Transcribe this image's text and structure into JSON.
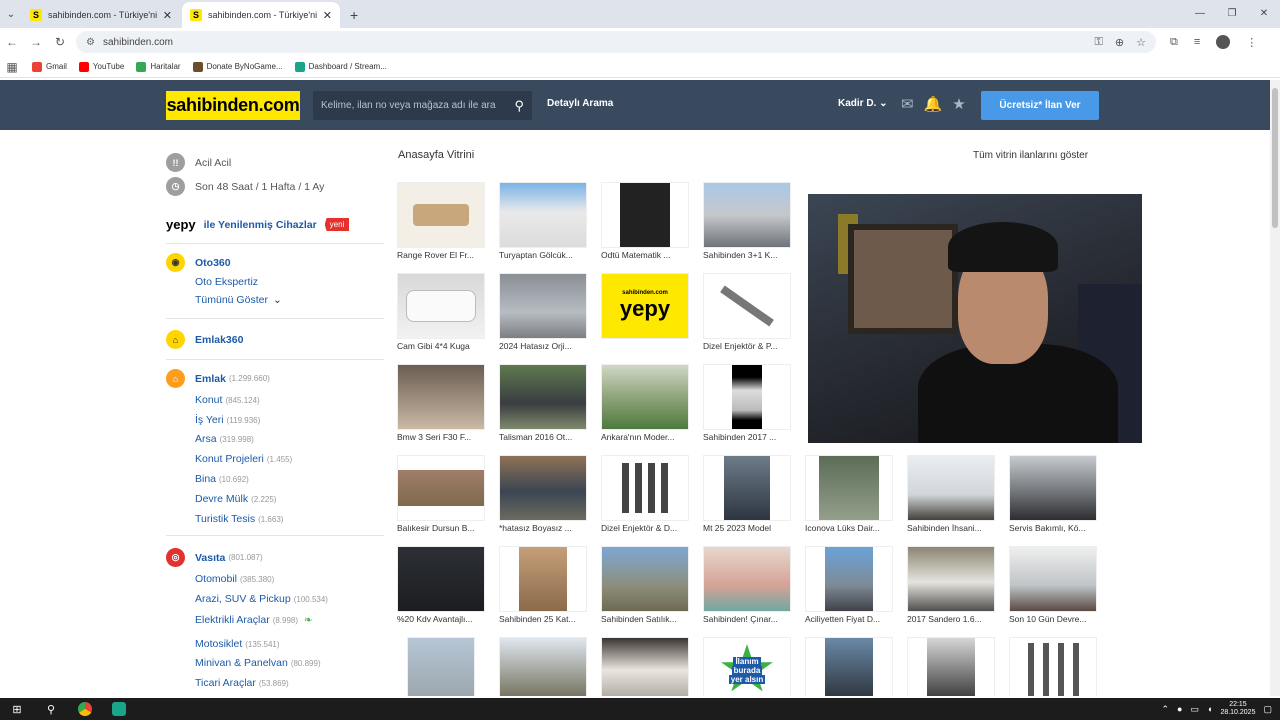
{
  "browser": {
    "tabs": [
      {
        "favicon": "S",
        "title": "sahibinden.com - Türkiye'nin O"
      },
      {
        "favicon": "S",
        "title": "sahibinden.com - Türkiye'nin O"
      }
    ],
    "new_tab": "+",
    "url": "sahibinden.com",
    "bookmarks": [
      {
        "label": "Gmail",
        "color": "#ea4335"
      },
      {
        "label": "YouTube",
        "color": "#ff0000"
      },
      {
        "label": "Haritalar",
        "color": "#34a853"
      },
      {
        "label": "Donate ByNoGame...",
        "color": "#6b4f2a"
      },
      {
        "label": "Dashboard / Stream...",
        "color": "#1aa58a"
      }
    ]
  },
  "header": {
    "logo": "sahibinden.com",
    "search_placeholder": "Kelime, ilan no veya mağaza adı ile ara",
    "advanced_search": "Detaylı Arama",
    "user": "Kadir D.",
    "cta": "Ücretsiz* İlan Ver",
    "accent": "#ffe800",
    "header_bg": "#3a4a5e",
    "cta_color": "#489ae9"
  },
  "sidebar": {
    "acil": "Acil Acil",
    "son48": "Son 48 Saat / 1 Hafta / 1 Ay",
    "yepy_logo": "yepy",
    "yepy_label": "ile Yenilenmiş Cihazlar",
    "yepy_badge": "yeni",
    "oto360": "Oto360",
    "oto_ekspertiz": "Oto Ekspertiz",
    "tumunu_goster": "Tümünü Göster",
    "emlak360": "Emlak360",
    "emlak": {
      "label": "Emlak",
      "count": "(1.299.660)"
    },
    "emlak_items": [
      {
        "label": "Konut",
        "count": "(845.124)"
      },
      {
        "label": "İş Yeri",
        "count": "(119.936)"
      },
      {
        "label": "Arsa",
        "count": "(319.998)"
      },
      {
        "label": "Konut Projeleri",
        "count": "(1.455)"
      },
      {
        "label": "Bina",
        "count": "(10.692)"
      },
      {
        "label": "Devre Mülk",
        "count": "(2.225)"
      },
      {
        "label": "Turistik Tesis",
        "count": "(1.663)"
      }
    ],
    "vasita": {
      "label": "Vasıta",
      "count": "(801.087)"
    },
    "vasita_items": [
      {
        "label": "Otomobil",
        "count": "(385.380)"
      },
      {
        "label": "Arazi, SUV & Pickup",
        "count": "(100.534)"
      },
      {
        "label": "Elektrikli Araçlar",
        "count": "(8.998)"
      },
      {
        "label": "Motosiklet",
        "count": "(135.541)"
      },
      {
        "label": "Minivan & Panelvan",
        "count": "(80.899)"
      },
      {
        "label": "Ticari Araçlar",
        "count": "(53.869)"
      }
    ]
  },
  "vitrin": {
    "title": "Anasayfa Vitrini",
    "show_all": "Tüm vitrin ilanlarını göster",
    "rows": [
      [
        "Range Rover El Fr...",
        "Turyaptan Gölcük...",
        "Odtü Matematik ...",
        "Sahibinden 3+1 K..."
      ],
      [
        "Cam Gibi 4*4 Kuga",
        "2024 Hatasız Orji...",
        "",
        "Dizel Enjektör & P..."
      ],
      [
        "Bmw 3 Seri F30 F...",
        "Talisman 2016 Ot...",
        "Ankara'nın Moder...",
        "Sahibinden 2017 ..."
      ],
      [
        "Balıkesir Dursun B...",
        "*hatasız Boyasız ...",
        "Dizel Enjektör & D...",
        "Mt 25 2023 Model",
        "Iconova Lüks Dair...",
        "Sahibinden İhsani...",
        "Servis Bakımlı, Kö..."
      ],
      [
        "%20 Kdv Avantajlı...",
        "Sahibinden 25 Kat...",
        "Sahibinden Satılık...",
        "Sahibinden! Çınar...",
        "Aciliyetten Fiyat D...",
        "2017 Sandero 1.6...",
        "Son 10 Gün Devre..."
      ],
      [
        "",
        "",
        "",
        "",
        "",
        "",
        ""
      ]
    ],
    "yepy_ad_small": "sahibinden.com",
    "yepy_ad_big": "yepy",
    "ilan_ad": [
      "İlanım",
      "burada",
      "yer alsın"
    ]
  },
  "taskbar": {
    "time": "22:15",
    "date": "28.10.2025"
  }
}
